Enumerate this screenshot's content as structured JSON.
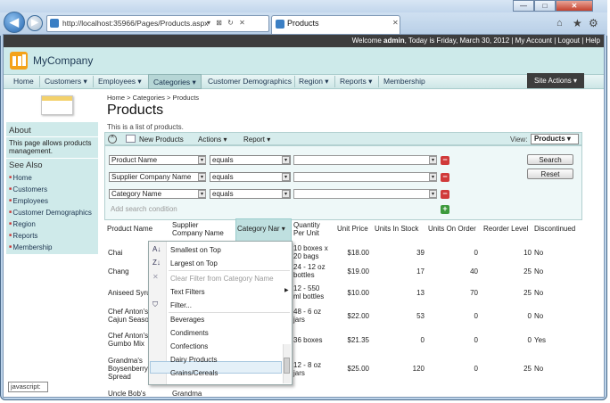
{
  "browser": {
    "url": "http://localhost:35966/Pages/Products.aspx",
    "url_tools": "▾ ⊠ ↻ ✕",
    "tab_title": "Products",
    "tab_close": "✕",
    "min": "—",
    "max": "□",
    "close": "✕",
    "back": "◀",
    "forward": "▶",
    "home_icon": "⌂",
    "star_icon": "★",
    "gear_icon": "⚙"
  },
  "topbar": {
    "prefix": "Welcome ",
    "user": "admin",
    "rest": ", Today is Friday, March 30, 2012 | My Account | Logout | Help"
  },
  "brand": "MyCompany",
  "menu": {
    "home": "Home",
    "customers": "Customers ▾",
    "employees": "Employees ▾",
    "categories": "Categories ▾",
    "customer_demographics": "Customer Demographics",
    "region": "Region ▾",
    "reports": "Reports ▾",
    "membership": "Membership",
    "site_actions": "Site Actions ▾"
  },
  "sidebar": {
    "about_title": "About",
    "about_text_1": "This page allows products",
    "about_text_2": "management.",
    "see_also_title": "See Also",
    "links": [
      "Home",
      "Customers",
      "Employees",
      "Customer Demographics",
      "Region",
      "Reports",
      "Membership"
    ]
  },
  "breadcrumb": {
    "home": "Home",
    "sep": ">",
    "categories": "Categories",
    "current": "Products"
  },
  "page": {
    "title": "Products",
    "description": "This is a list of products."
  },
  "actionbar": {
    "collapse": "^",
    "new": "New Products",
    "actions": "Actions ▾",
    "report": "Report ▾",
    "view_label": "View:",
    "view_value": "Products ▾"
  },
  "filters": {
    "rows": [
      {
        "field": "Product Name",
        "op": "equals"
      },
      {
        "field": "Supplier Company Name",
        "op": "equals"
      },
      {
        "field": "Category Name",
        "op": "equals"
      }
    ],
    "add": "Add search condition",
    "search": "Search",
    "reset": "Reset",
    "arrow": "▾",
    "minus": "−",
    "plus": "+"
  },
  "grid": {
    "headers": {
      "product": "Product Name",
      "supplier_1": "Supplier",
      "supplier_2": "Company Name",
      "category": "Category Nar ▾",
      "qty_1": "Quantity",
      "qty_2": "Per Unit",
      "price": "Unit Price",
      "stock": "Units In Stock",
      "order": "Units On Order",
      "reorder": "Reorder Level",
      "disc": "Discontinued"
    },
    "rows": [
      {
        "p1": "Chai",
        "p2": "",
        "q1": "10 boxes x",
        "q2": "20 bags",
        "price": "$18.00",
        "stock": "39",
        "order": "0",
        "reorder": "10",
        "disc": "No"
      },
      {
        "p1": "Chang",
        "p2": "",
        "q1": "24 - 12 oz",
        "q2": "bottles",
        "price": "$19.00",
        "stock": "17",
        "order": "40",
        "reorder": "25",
        "disc": "No"
      },
      {
        "p1": "Aniseed Syru",
        "p2": "",
        "q1": "12 - 550",
        "q2": "ml bottles",
        "price": "$10.00",
        "stock": "13",
        "order": "70",
        "reorder": "25",
        "disc": "No"
      },
      {
        "p1": "Chef Anton's",
        "p2": "Cajun Seaso",
        "q1": "48 - 6 oz",
        "q2": "jars",
        "price": "$22.00",
        "stock": "53",
        "order": "0",
        "reorder": "0",
        "disc": "No"
      },
      {
        "p1": "Chef Anton's",
        "p2": "Gumbo Mix",
        "q1": "36 boxes",
        "q2": "",
        "price": "$21.35",
        "stock": "0",
        "order": "0",
        "reorder": "0",
        "disc": "Yes"
      },
      {
        "p1": "Grandma's",
        "p2": "Boysenberry",
        "p3": "Spread",
        "q1": "12 - 8 oz",
        "q2": "jars",
        "price": "$25.00",
        "stock": "120",
        "order": "0",
        "reorder": "25",
        "disc": "No"
      }
    ],
    "partial_row": {
      "p1": "Uncle Bob's",
      "supplier": "Grandma"
    }
  },
  "dropdown": {
    "smallest": "Smallest on Top",
    "largest": "Largest on Top",
    "clear": "Clear Filter from Category Name",
    "text_filters": "Text Filters",
    "filter": "Filter...",
    "submenu_arrow": "▶",
    "sort_az": "A↓",
    "sort_za": "Z↓",
    "funnel": "⛉",
    "clear_icon": "✕",
    "values": [
      "Beverages",
      "Condiments",
      "Confections",
      "Dairy Products",
      "Grains/Cereals"
    ]
  },
  "status": "javascript:"
}
